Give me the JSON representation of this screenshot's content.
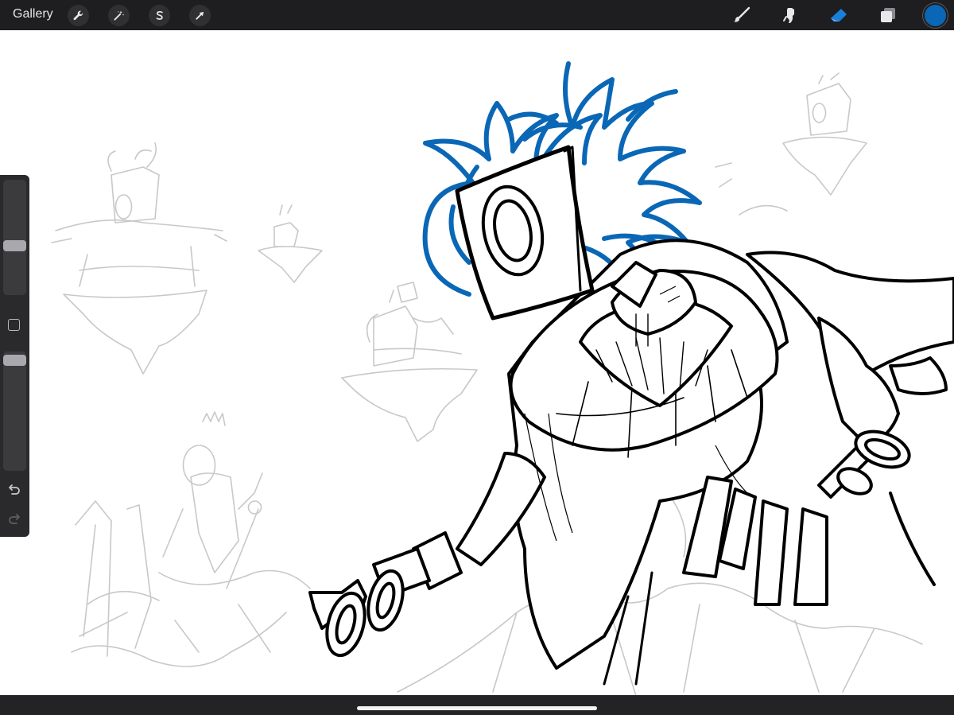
{
  "toolbar": {
    "gallery_label": "Gallery",
    "left_actions": [
      {
        "name": "actions-wrench-icon"
      },
      {
        "name": "adjustments-wand-icon"
      },
      {
        "name": "selection-s-icon"
      },
      {
        "name": "transform-arrow-icon"
      }
    ],
    "right_tools": [
      {
        "name": "brush-icon"
      },
      {
        "name": "smudge-icon"
      },
      {
        "name": "eraser-icon",
        "active": true
      },
      {
        "name": "layers-icon"
      }
    ],
    "current_color": "#0a67b6"
  },
  "sidebar": {
    "brush_size_level": 0.55,
    "opacity_level": 0.92,
    "modify_button": "square-modify-icon",
    "undo_icon": "undo-icon",
    "redo_icon": "redo-icon"
  },
  "colors": {
    "accent": "#1a7fd8",
    "line_art": "#000000",
    "sketch": "#cccccc",
    "hair": "#0a67b6"
  }
}
